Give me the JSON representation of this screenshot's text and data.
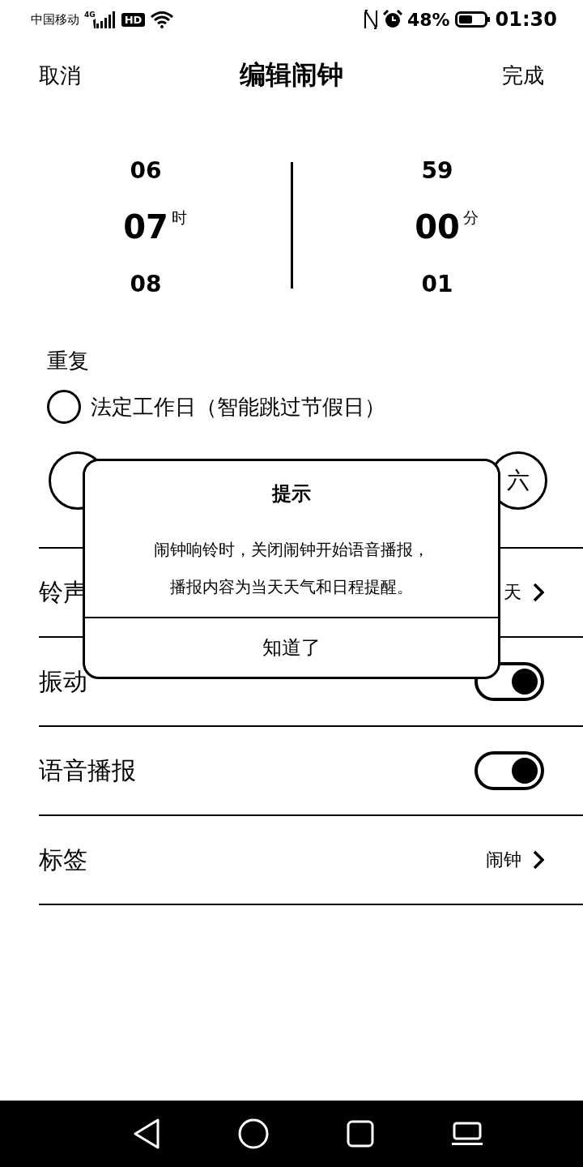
{
  "status_bar": {
    "carrier": "中国移动",
    "network": "4G",
    "hd": "HD",
    "battery": "48%",
    "time": "01:30"
  },
  "header": {
    "cancel": "取消",
    "title": "编辑闹钟",
    "done": "完成"
  },
  "picker": [
    {
      "prev": "06",
      "current": "07",
      "next": "08",
      "unit": "时"
    },
    {
      "prev": "59",
      "current": "00",
      "next": "01",
      "unit": "分"
    }
  ],
  "repeat": {
    "label": "重复",
    "workday": {
      "label": "法定工作日（智能跳过节假日）",
      "checked": false
    },
    "days": [
      {
        "selected": false
      },
      {
        "label": "六",
        "selected": false
      }
    ]
  },
  "settings": [
    {
      "kind": "link",
      "label": "铃声",
      "value": "天"
    },
    {
      "kind": "toggle",
      "label": "振动",
      "on": true
    },
    {
      "kind": "toggle",
      "label": "语音播报",
      "on": true
    },
    {
      "kind": "link",
      "label": "标签",
      "value": "闹钟"
    }
  ],
  "dialog": {
    "title": "提示",
    "message": [
      "闹钟响铃时，关闭闹钟开始语音播报，",
      "播报内容为当天天气和日程提醒。"
    ],
    "button": "知道了"
  }
}
